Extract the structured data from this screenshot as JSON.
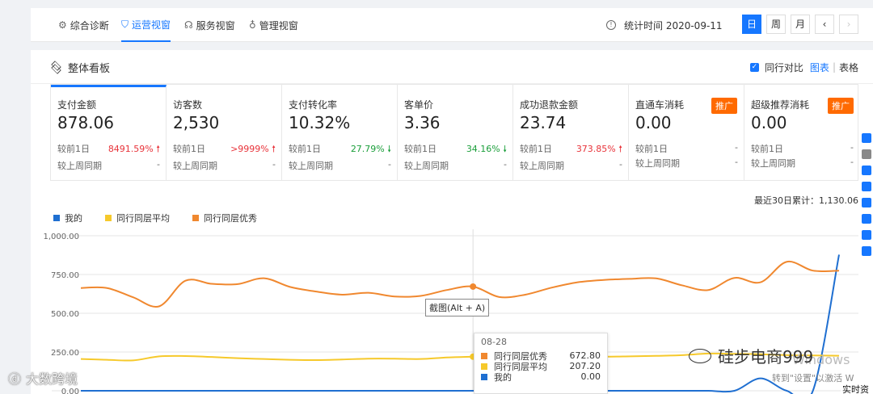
{
  "nav": {
    "tabs": [
      {
        "label": "综合诊断",
        "icon": "diagnosis-icon"
      },
      {
        "label": "运营视窗",
        "icon": "shield-icon"
      },
      {
        "label": "服务视窗",
        "icon": "headset-icon"
      },
      {
        "label": "管理视窗",
        "icon": "bulb-icon"
      }
    ],
    "stat_time": "统计时间 2020-09-11",
    "day": "日",
    "week": "周",
    "month": "月",
    "prev": "‹",
    "next": "›"
  },
  "panel": {
    "title": "整体看板",
    "compare_label": "同行对比",
    "view_chart": "图表",
    "view_sep": "|",
    "view_table": "表格"
  },
  "cards": [
    {
      "name": "支付金额",
      "value": "878.06",
      "r1_label": "较前1日",
      "r1_value": "8491.59%",
      "r1_dir": "up",
      "r2_label": "较上周同期",
      "r2_value": "-",
      "badge": ""
    },
    {
      "name": "访客数",
      "value": "2,530",
      "r1_label": "较前1日",
      "r1_value": ">9999%",
      "r1_dir": "up",
      "r2_label": "较上周同期",
      "r2_value": "-",
      "badge": ""
    },
    {
      "name": "支付转化率",
      "value": "10.32%",
      "r1_label": "较前1日",
      "r1_value": "27.79%",
      "r1_dir": "down",
      "r2_label": "较上周同期",
      "r2_value": "-",
      "badge": ""
    },
    {
      "name": "客单价",
      "value": "3.36",
      "r1_label": "较前1日",
      "r1_value": "34.16%",
      "r1_dir": "down",
      "r2_label": "较上周同期",
      "r2_value": "-",
      "badge": ""
    },
    {
      "name": "成功退款金额",
      "value": "23.74",
      "r1_label": "较前1日",
      "r1_value": "373.85%",
      "r1_dir": "up",
      "r2_label": "较上周同期",
      "r2_value": "-",
      "badge": ""
    },
    {
      "name": "直通车消耗",
      "value": "0.00",
      "r1_label": "较前1日",
      "r1_value": "-",
      "r1_dir": "none",
      "r2_label": "较上周同期",
      "r2_value": "-",
      "badge": "推广"
    },
    {
      "name": "超级推荐消耗",
      "value": "0.00",
      "r1_label": "较前1日",
      "r1_value": "-",
      "r1_dir": "none",
      "r2_label": "较上周同期",
      "r2_value": "-",
      "badge": "推广"
    }
  ],
  "total_30d": "最近30日累计：1,130.06",
  "chart_data": {
    "type": "line",
    "ylim": [
      0,
      1000
    ],
    "yticks": [
      "1,000.00",
      "750.00",
      "500.00",
      "250.00",
      "0.00"
    ],
    "series": [
      {
        "name": "我的",
        "color": "#1f6fd1",
        "values": [
          0,
          0,
          0,
          0,
          0,
          0,
          0,
          0,
          0,
          0,
          0,
          0,
          0,
          0,
          0,
          0,
          0,
          0,
          0,
          0,
          0,
          0,
          0,
          0,
          0,
          0,
          80,
          0,
          0,
          878
        ]
      },
      {
        "name": "同行同层平均",
        "color": "#f6c92b",
        "values": [
          205,
          200,
          196,
          222,
          224,
          218,
          210,
          205,
          200,
          198,
          202,
          207,
          207,
          205,
          215,
          220,
          224,
          228,
          230,
          224,
          220,
          222,
          225,
          230,
          240,
          238,
          236,
          230,
          228,
          226
        ]
      },
      {
        "name": "同行同层优秀",
        "color": "#f0882f",
        "values": [
          663,
          663,
          603,
          545,
          710,
          690,
          688,
          726,
          670,
          640,
          620,
          632,
          608,
          612,
          650,
          672,
          605,
          620,
          665,
          700,
          715,
          722,
          725,
          680,
          650,
          728,
          700,
          832,
          775,
          775
        ]
      }
    ],
    "tooltip": {
      "date": "08-28",
      "rows": [
        {
          "name": "同行同层优秀",
          "value": "672.80",
          "color": "#f0882f"
        },
        {
          "name": "同行同层平均",
          "value": "207.20",
          "color": "#f6c92b"
        },
        {
          "name": "我的",
          "value": "0.00",
          "color": "#1f6fd1"
        }
      ]
    },
    "highlight_index": 15
  },
  "overlay": {
    "screenshot_hint": "截图(Alt + A)",
    "wm_left": "大数跨境",
    "wm_brand": "硅步电商999",
    "wm_win": "Windows",
    "wm_activate": "转到\"设置\"以激活 W",
    "wm_realtime": "实时资"
  }
}
